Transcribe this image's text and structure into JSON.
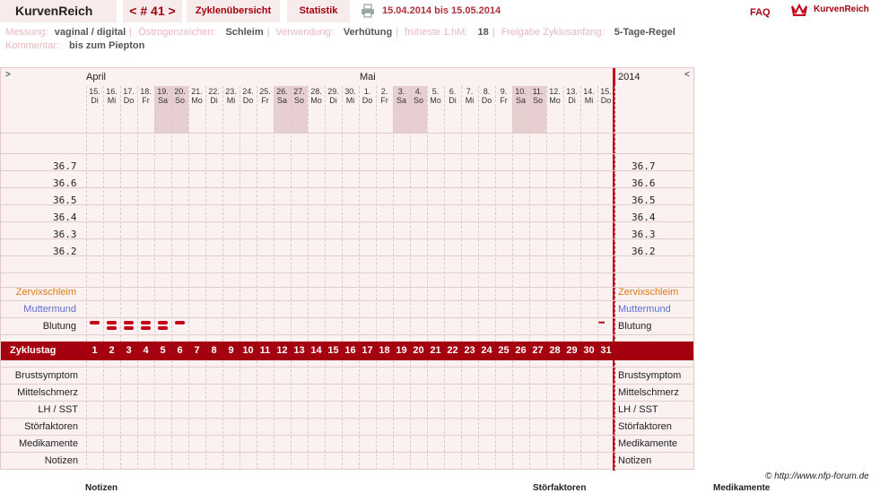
{
  "app": {
    "title": "KurvenReich",
    "cycle": "< # 41 >",
    "nav": [
      "Zyklenübersicht",
      "Statistik"
    ],
    "date_range": "15.04.2014 bis 15.05.2014",
    "faq": "FAQ",
    "logo": "KurvenReich"
  },
  "info": {
    "messung_label": "Messung:",
    "messung": "vaginal / digital",
    "oestrogen_label": "Östrogenzeichen:",
    "oestrogen": "Schleim",
    "verwendung_label": "Verwendung:",
    "verwendung": "Verhütung",
    "hm_label": "früheste 1.hM:",
    "hm": "18",
    "freigabe_label": "Freigabe Zyklusanfang:",
    "freigabe": "5-Tage-Regel",
    "kommentar_label": "Kommentar:",
    "kommentar": "bis zum Piepton"
  },
  "chart": {
    "nav_left": ">",
    "nav_right": "<",
    "month1": "April",
    "month2": "Mai",
    "year": "2014",
    "days": [
      [
        "15.",
        "Di"
      ],
      [
        "16.",
        "Mi"
      ],
      [
        "17.",
        "Do"
      ],
      [
        "18.",
        "Fr"
      ],
      [
        "19.",
        "Sa"
      ],
      [
        "20.",
        "So"
      ],
      [
        "21.",
        "Mo"
      ],
      [
        "22.",
        "Di"
      ],
      [
        "23.",
        "Mi"
      ],
      [
        "24.",
        "Do"
      ],
      [
        "25.",
        "Fr"
      ],
      [
        "26.",
        "Sa"
      ],
      [
        "27.",
        "So"
      ],
      [
        "28.",
        "Mo"
      ],
      [
        "29.",
        "Di"
      ],
      [
        "30.",
        "Mi"
      ],
      [
        "1.",
        "Do"
      ],
      [
        "2.",
        "Fr"
      ],
      [
        "3.",
        "Sa"
      ],
      [
        "4.",
        "So"
      ],
      [
        "5.",
        "Mo"
      ],
      [
        "6.",
        "Di"
      ],
      [
        "7.",
        "Mi"
      ],
      [
        "8.",
        "Do"
      ],
      [
        "9.",
        "Fr"
      ],
      [
        "10.",
        "Sa"
      ],
      [
        "11.",
        "So"
      ],
      [
        "12.",
        "Mo"
      ],
      [
        "13.",
        "Di"
      ],
      [
        "14.",
        "Mi"
      ],
      [
        "15.",
        "Do"
      ]
    ],
    "weekend_indices": [
      4,
      5,
      11,
      12,
      18,
      19,
      25,
      26
    ],
    "temps": [
      "36.7",
      "36.6",
      "36.5",
      "36.4",
      "36.3",
      "36.2"
    ],
    "zervix": "Zervixschleim",
    "muttermund": "Muttermund",
    "blutung": "Blutung",
    "zyklustag": "Zyklustag",
    "cycle_days": [
      "1",
      "2",
      "3",
      "4",
      "5",
      "6",
      "7",
      "8",
      "9",
      "10",
      "11",
      "12",
      "13",
      "14",
      "15",
      "16",
      "17",
      "18",
      "19",
      "20",
      "21",
      "22",
      "23",
      "24",
      "25",
      "26",
      "27",
      "28",
      "29",
      "30",
      "31"
    ],
    "bleeding_levels": [
      1,
      2,
      2,
      2,
      2,
      1,
      0,
      0,
      0,
      0,
      0,
      0,
      0,
      0,
      0,
      0,
      0,
      0,
      0,
      0,
      0,
      0,
      0,
      0,
      0,
      0,
      0,
      0,
      0,
      0,
      "spot"
    ],
    "lower_rows": [
      "Brustsymptom",
      "Mittelschmerz",
      "LH / SST",
      "Störfaktoren",
      "Medikamente",
      "Notizen"
    ],
    "colors": {
      "accent": "#a50010",
      "zervix": "#e07a10",
      "muttermund": "#5b6fd0",
      "bleeding": "#c2001a"
    }
  },
  "footer": {
    "credit": "© http://www.nfp-forum.de",
    "bottom": [
      "Notizen",
      "Störfaktoren",
      "Medikamente"
    ]
  }
}
